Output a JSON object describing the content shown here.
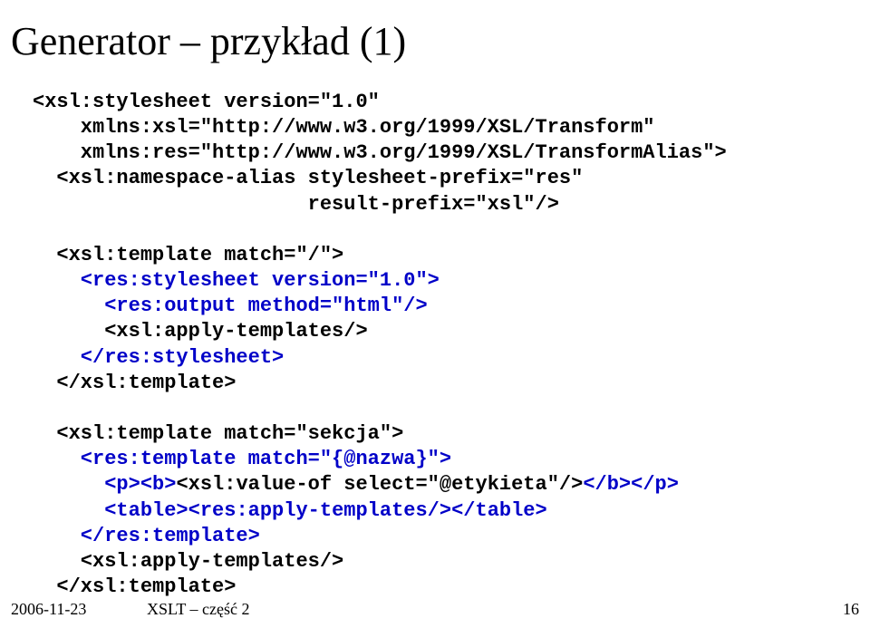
{
  "title": "Generator – przykład (1)",
  "code": {
    "l1": "<xsl:stylesheet version=\"1.0\"",
    "l2": "    xmlns:xsl=\"http://www.w3.org/1999/XSL/Transform\"",
    "l3": "    xmlns:res=\"http://www.w3.org/1999/XSL/TransformAlias\">",
    "l4": "  <xsl:namespace-alias stylesheet-prefix=\"res\"",
    "l5": "                       result-prefix=\"xsl\"/>",
    "l6": "",
    "l7": "  <xsl:template match=\"/\">",
    "l8": "    <res:stylesheet version=\"1.0\">",
    "l9": "      <res:output method=\"html\"/>",
    "l10": "      <xsl:apply-templates/>",
    "l11": "    </res:stylesheet>",
    "l12": "  </xsl:template>",
    "l13": "",
    "l14": "  <xsl:template match=\"sekcja\">",
    "l15": "    <res:template match=\"{@nazwa}\">",
    "l16a": "      <p><b>",
    "l16b": "<xsl:value-of select=\"@etykieta\"/>",
    "l16c": "</b></p>",
    "l17a": "      <table>",
    "l17b": "<res:apply-templates/>",
    "l17c": "</table>",
    "l18": "    </res:template>",
    "l19": "    <xsl:apply-templates/>",
    "l20": "  </xsl:template>"
  },
  "footer": {
    "date": "2006-11-23",
    "mid": "XSLT – część 2",
    "page": "16"
  }
}
